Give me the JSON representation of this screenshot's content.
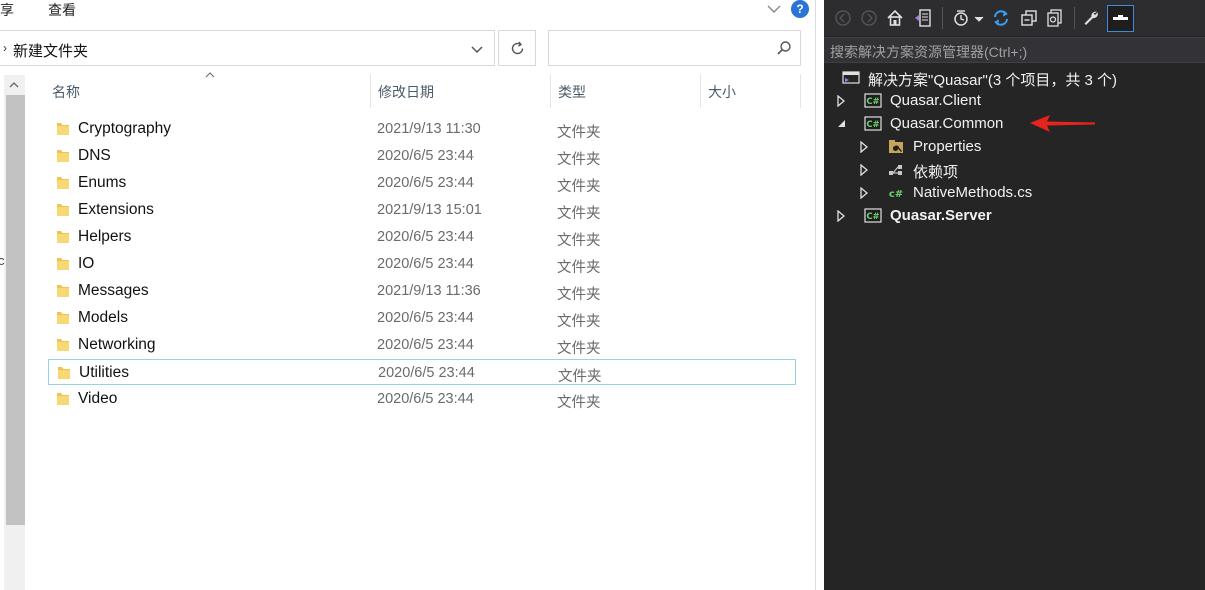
{
  "explorer": {
    "ribbon_tabs": [
      "享",
      "查看"
    ],
    "help_label": "?",
    "address": "新建文件夹",
    "search_placeholder": "",
    "nav_edge_chars": [
      "",
      "",
      "",
      "",
      "",
      "c"
    ],
    "columns": {
      "name": "名称",
      "date": "修改日期",
      "type": "类型",
      "size": "大小"
    },
    "files": [
      {
        "name": "Cryptography",
        "date": "2021/9/13 11:30",
        "type": "文件夹",
        "selected": false
      },
      {
        "name": "DNS",
        "date": "2020/6/5 23:44",
        "type": "文件夹",
        "selected": false
      },
      {
        "name": "Enums",
        "date": "2020/6/5 23:44",
        "type": "文件夹",
        "selected": false
      },
      {
        "name": "Extensions",
        "date": "2021/9/13 15:01",
        "type": "文件夹",
        "selected": false
      },
      {
        "name": "Helpers",
        "date": "2020/6/5 23:44",
        "type": "文件夹",
        "selected": false
      },
      {
        "name": "IO",
        "date": "2020/6/5 23:44",
        "type": "文件夹",
        "selected": false
      },
      {
        "name": "Messages",
        "date": "2021/9/13 11:36",
        "type": "文件夹",
        "selected": false
      },
      {
        "name": "Models",
        "date": "2020/6/5 23:44",
        "type": "文件夹",
        "selected": false
      },
      {
        "name": "Networking",
        "date": "2020/6/5 23:44",
        "type": "文件夹",
        "selected": false
      },
      {
        "name": "Utilities",
        "date": "2020/6/5 23:44",
        "type": "文件夹",
        "selected": true
      },
      {
        "name": "Video",
        "date": "2020/6/5 23:44",
        "type": "文件夹",
        "selected": false
      }
    ]
  },
  "solution_explorer": {
    "search_placeholder": "搜索解决方案资源管理器(Ctrl+;)",
    "solution_label": "解决方案\"Quasar\"(3 个项目，共 3 个)",
    "projects": [
      {
        "name": "Quasar.Client",
        "expanded": false,
        "bold": false
      },
      {
        "name": "Quasar.Common",
        "expanded": true,
        "bold": false
      },
      {
        "name": "Quasar.Server",
        "expanded": false,
        "bold": true
      }
    ],
    "common_children": [
      {
        "name": "Properties",
        "icon": "properties-icon"
      },
      {
        "name": "依赖项",
        "icon": "dependencies-icon"
      },
      {
        "name": "NativeMethods.cs",
        "icon": "csharp-file-icon"
      }
    ],
    "cs_badge": "C#",
    "cs_file_badge": "c#"
  },
  "colors": {
    "vs_background": "#252526",
    "vs_toolbar": "#2d2d30",
    "selection_border": "#99d1e3",
    "folder_yellow": "#f8d775",
    "annotation_red": "#e8231b",
    "vs_accent": "#3f8ad8"
  }
}
